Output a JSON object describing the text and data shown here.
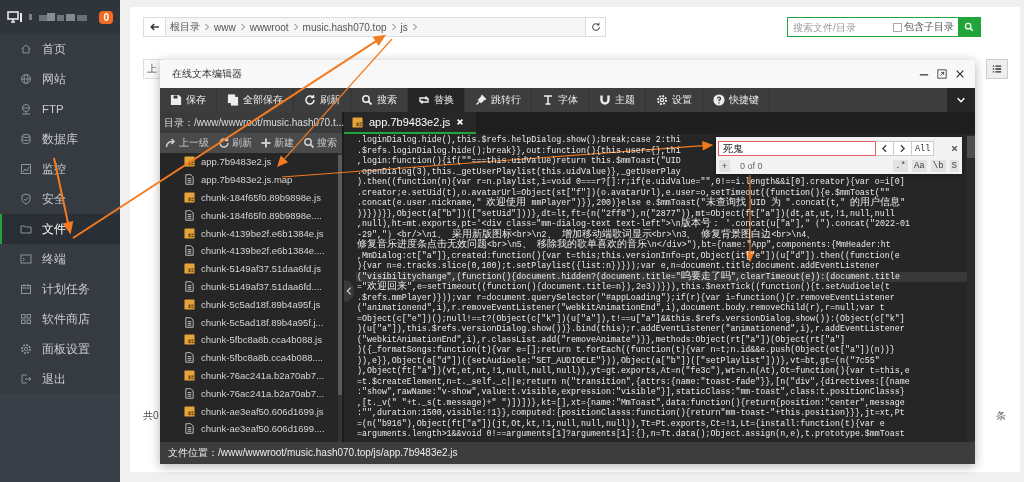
{
  "sidebar": {
    "badge": "0",
    "items": [
      {
        "label": "首页",
        "selected": false
      },
      {
        "label": "网站",
        "selected": false
      },
      {
        "label": "FTP",
        "selected": false
      },
      {
        "label": "数据库",
        "selected": false
      },
      {
        "label": "监控",
        "selected": false
      },
      {
        "label": "安全",
        "selected": false
      },
      {
        "label": "文件",
        "selected": true
      },
      {
        "label": "终端",
        "selected": false
      },
      {
        "label": "计划任务",
        "selected": false
      },
      {
        "label": "软件商店",
        "selected": false
      },
      {
        "label": "面板设置",
        "selected": false
      },
      {
        "label": "退出",
        "selected": false
      }
    ]
  },
  "file_manager": {
    "crumbs": [
      "根目录",
      "www",
      "wwwroot",
      "music.hash070.top",
      "js"
    ],
    "search": {
      "placeholder": "搜索文件/目录",
      "include_label": "包含子目录",
      "include_checked": false
    },
    "toolbar_button": "上",
    "footer_left": "共0",
    "footer_right": "条"
  },
  "editor": {
    "title": "在线文本编辑器",
    "toolbar": [
      {
        "label": "保存",
        "selected": false
      },
      {
        "label": "全部保存",
        "selected": false
      },
      {
        "label": "刷新",
        "selected": false
      },
      {
        "label": "搜索",
        "selected": false
      },
      {
        "label": "替换",
        "selected": true
      },
      {
        "label": "跳转行",
        "selected": false
      },
      {
        "label": "字体",
        "selected": false
      },
      {
        "label": "主题",
        "selected": false
      },
      {
        "label": "设置",
        "selected": false
      },
      {
        "label": "快捷键",
        "selected": false
      }
    ],
    "directory": "目录：/www/wwwroot/music.hash070.t...",
    "file_actions": [
      "上一级",
      "刷新",
      "新建",
      "搜索"
    ],
    "files": [
      {
        "name": "app.7b9483e2.js",
        "kind": "js"
      },
      {
        "name": "app.7b9483e2.js.map",
        "kind": "file"
      },
      {
        "name": "chunk-184f65f0.89b9898e.js",
        "kind": "js"
      },
      {
        "name": "chunk-184f65f0.89b9898e....",
        "kind": "file"
      },
      {
        "name": "chunk-4139be2f.e6b1384e.js",
        "kind": "js"
      },
      {
        "name": "chunk-4139be2f.e6b1384e....",
        "kind": "file"
      },
      {
        "name": "chunk-5149af37.51daa6fd.js",
        "kind": "js"
      },
      {
        "name": "chunk-5149af37.51daa6fd....",
        "kind": "file"
      },
      {
        "name": "chunk-5c5ad18f.89b4a95f.js",
        "kind": "js"
      },
      {
        "name": "chunk-5c5ad18f.89b4a95f.j...",
        "kind": "file"
      },
      {
        "name": "chunk-5fbc8a8b.cca4b088.js",
        "kind": "js"
      },
      {
        "name": "chunk-5fbc8a8b.cca4b088....",
        "kind": "file"
      },
      {
        "name": "chunk-76ac241a.b2a70ab7...",
        "kind": "js"
      },
      {
        "name": "chunk-76ac241a.b2a70ab7...",
        "kind": "file"
      },
      {
        "name": "chunk-ae3eaf50.606d1699.js",
        "kind": "js"
      },
      {
        "name": "chunk-ae3eaf50.606d1699....",
        "kind": "file"
      }
    ],
    "tabs": [
      {
        "label": "app.7b9483e2.js",
        "selected": true
      }
    ],
    "code_lines": [
      {
        "text": ".loginDialog.hide(),this.$refs.helpDialog.show();break;case 2:thi",
        "active": false
      },
      {
        "text": ".$refs.loginDialog.hide();break}},out:function(){this.user={},thi",
        "active": false
      },
      {
        "text": ",login:function(){if(\"\"===this.uidValue)return this.$mmToast(\"UID",
        "active": false
      },
      {
        "text": ".openDialog(3),this._getUserPlaylist(this.uidValue)},_getUserPlay",
        "active": false
      },
      {
        "text": ").then((function(n){var r=n.playlist,i=void 0===r?[]:r;if(e.uidValue=\"\",0!==i.length&&i[0].creator){var o=i[0]",
        "active": false
      },
      {
        "text": ".creator;e.setUid(t),o.avatarUrl=Object(st[\"f\"])(o.avatarUrl),e.user=o,setTimeout((function(){e.$mmToast(\"\"",
        "active": false
      },
      {
        "text": ".concat(e.user.nickname,\" 欢迎使用 mmPlayer\")}),200)}else e.$mmToast(\"未查询找 UID 为 \".concat(t,\" 的用户信息\"",
        "active": false
      },
      {
        "text": "))}))}},Object(a[\"b\"])([\"setUid\"]))},dt=lt,ft=(n(\"2ff8\"),n(\"2877\")),mt=Object(ft[\"a\"])(dt,at,ut,!1,null,null",
        "active": false
      },
      {
        "text": ",null),ht=mt.exports,pt='<div class=\"mm-dialog-text text-left\">\\n版本号： '.concat(u[\"a\"],\"（\").concat(\"2022-01",
        "active": false
      },
      {
        "text": "-29\",\"）<br/>\\n1、 采用新版图标<br>\\n2、 增加移动端歌词显示<br>\\n3、 修复背景图白边<br>\\n4、",
        "active": false
      },
      {
        "text": "修复音乐进度条点击无效问题<br>\\n5、 移除我的歌单喜欢的音乐\\n</div>\"),bt={name:\"App\",components:{MmHeader:ht",
        "active": false
      },
      {
        "text": ",MmDialog:ct[\"a\"]},created:function(){var t=this;this.versionInfo=pt,Object(it[\"e\"])(u[\"d\"]).then((function(e",
        "active": false
      },
      {
        "text": "){var n=e.tracks.slice(0,100);t.setPlaylist({list:n})}));var e,n=document.title;document.addEventListener",
        "active": false
      },
      {
        "text": "(\"visibilitychange\",(function(){document.hidden?(document.title=\"呜要走了吗\",clearTimeout(e)):(document.title",
        "active": true
      },
      {
        "text": "=\"欢迎回来\",e=setTimeout((function(){document.title=n}),2e3))})),this.$nextTick((function(){t.setAudioele(t",
        "active": false
      },
      {
        "text": ".$refs.mmPlayer)}));var r=document.querySelector(\"#appLoading\");if(r){var i=function(){r.removeEventListener",
        "active": false
      },
      {
        "text": "(\"animationend\",i),r.removeEventListener(\"webkitAnimationEnd\",i),document.body.removeChild(r),r=null;var t",
        "active": false
      },
      {
        "text": "=Object(c[\"e\"])();null!==t?(Object(c[\"k\"])(u[\"a\"]),t!==u[\"a\"]&&this.$refs.versionDialog.show()):(Object(c[\"k\"]",
        "active": false
      },
      {
        "text": ")(u[\"a\"]),this.$refs.versionDialog.show())}.bind(this);r.addEventListener(\"animationend\",i),r.addEventListener",
        "active": false
      },
      {
        "text": "(\"webkitAnimationEnd\",i),r.classList.add(\"removeAnimate\")}},methods:Object(rt[\"a\"])(Object(rt[\"a\"]",
        "active": false
      },
      {
        "text": ")({_formatSongs:function(t){var e=[];return t.forEach((function(t){var n=t;n.id&&e.push(Object(ot[\"a\"])(n))}",
        "active": false
      },
      {
        "text": ")),e}},Object(a[\"d\"])({setAudioele:\"SET_AUDIOELE\"})),Object(a[\"b\"])([\"setPlaylist\"]))},vt=bt,gt=(n(\"7c55\"",
        "active": false
      },
      {
        "text": "),Object(ft[\"a\"])(vt,et,nt,!1,null,null,null)),yt=gt.exports,At=n(\"fe3c\"),wt=n.n(At),Ot=function(){var t=this,e",
        "active": false
      },
      {
        "text": "=t.$createElement,n=t._self._c||e;return n(\"transition\",{attrs:{name:\"toast-fade\"}},[n(\"div\",{directives:[{name",
        "active": false
      },
      {
        "text": ":\"show\",rawName:\"v-show\",value:t.visible,expression:\"visible\"}],staticClass:\"mm-toast\",class:t.positionClasss}",
        "active": false
      },
      {
        "text": ",[t._v(\" \"+t._s(t.message)+\" \")])])},kt=[],xt={name:\"MmToast\",data:function(){return{position:\"center\",message",
        "active": false
      },
      {
        "text": ":\"\",duration:1500,visible:!1}},computed:{positionClasss:function(){return\"mm-toast-\"+this.position}}},jt=xt,Pt",
        "active": false
      },
      {
        "text": "=(n(\"b916\"),Object(ft[\"a\"])(jt,Ot,kt,!1,null,null,null)),Tt=Pt.exports,Ct=!1,Lt={install:function(t){var e",
        "active": false
      },
      {
        "text": "=arguments.length>1&&void 0!==arguments[1]?arguments[1]:{},n=Tt.data();Object.assign(n,e),t.prototype.$mmToast",
        "active": false
      }
    ],
    "find": {
      "value": "死鬼",
      "all": "All",
      "add": "+",
      "count": "0 of 0",
      "options": [
        ".*",
        "Aa",
        "\\b",
        "S"
      ]
    },
    "status": "文件位置：/www/wwwroot/music.hash070.top/js/app.7b9483e2.js"
  }
}
